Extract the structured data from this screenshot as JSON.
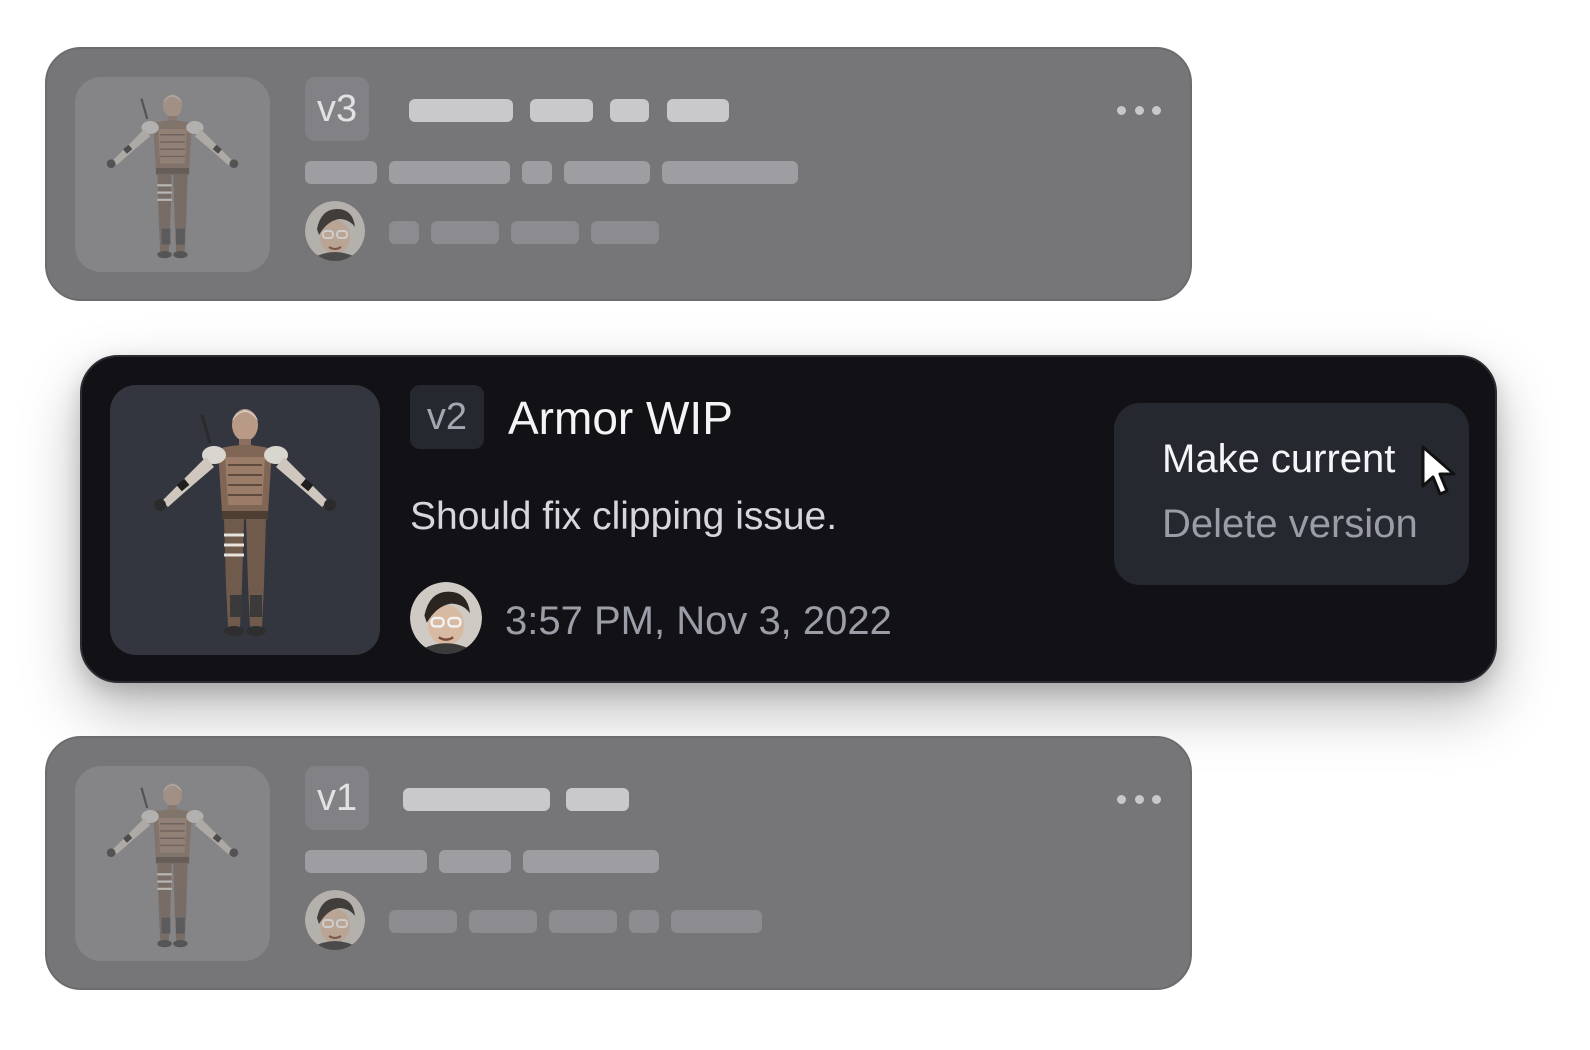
{
  "versions": [
    {
      "badge": "v3",
      "state": "faded"
    },
    {
      "badge": "v2",
      "state": "active",
      "title": "Armor WIP",
      "description": "Should fix clipping issue.",
      "timestamp": "3:57 PM, Nov 3, 2022",
      "menu": {
        "make_current": "Make current",
        "delete": "Delete version"
      }
    },
    {
      "badge": "v1",
      "state": "faded"
    }
  ],
  "icons": {
    "more": "more-horizontal-icon",
    "cursor": "mouse-pointer-icon"
  },
  "colors": {
    "active_card_bg": "#121216",
    "faded_card_bg": "#767678",
    "menu_bg": "#262830"
  }
}
